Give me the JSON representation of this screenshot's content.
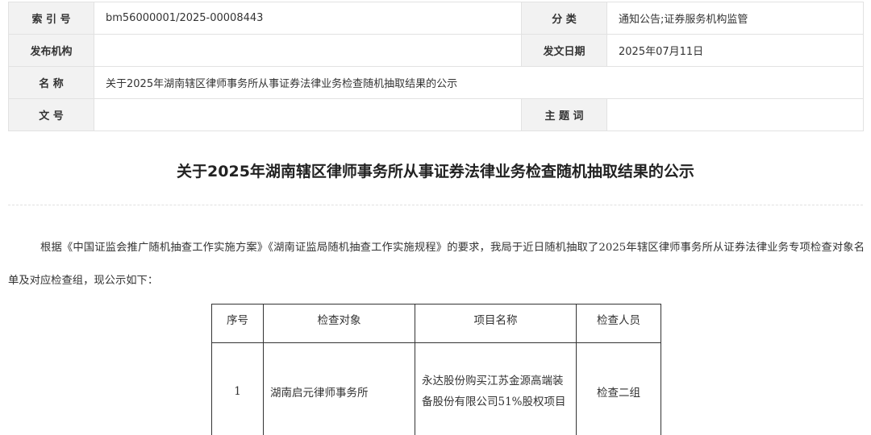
{
  "meta": {
    "rows": [
      {
        "label": "索 引 号",
        "value": "bm56000001/2025-00008443",
        "label2": "分 类",
        "value2": "通知公告;证券服务机构监管"
      },
      {
        "label": "发布机构",
        "value": "",
        "label2": "发文日期",
        "value2": "2025年07月11日"
      },
      {
        "label": "名 称",
        "value": "关于2025年湖南辖区律师事务所从事证券法律业务检查随机抽取结果的公示"
      },
      {
        "label": "文 号",
        "value": "",
        "label2": "主 题 词",
        "value2": ""
      }
    ]
  },
  "article": {
    "title": "关于2025年湖南辖区律师事务所从事证券法律业务检查随机抽取结果的公示",
    "paragraph": "根据《中国证监会推广随机抽查工作实施方案》《湖南证监局随机抽查工作实施规程》的要求，我局于近日随机抽取了2025年辖区律师事务所从证券法律业务专项检查对象名单及对应检查组，现公示如下："
  },
  "results_table": {
    "headers": [
      "序号",
      "检查对象",
      "项目名称",
      "检查人员"
    ],
    "rows": [
      {
        "no": "1",
        "target": "湖南启元律师事务所",
        "project": "永达股份购买江苏金源高端装备股份有限公司51%股权项目",
        "inspector": "检查二组"
      }
    ]
  }
}
